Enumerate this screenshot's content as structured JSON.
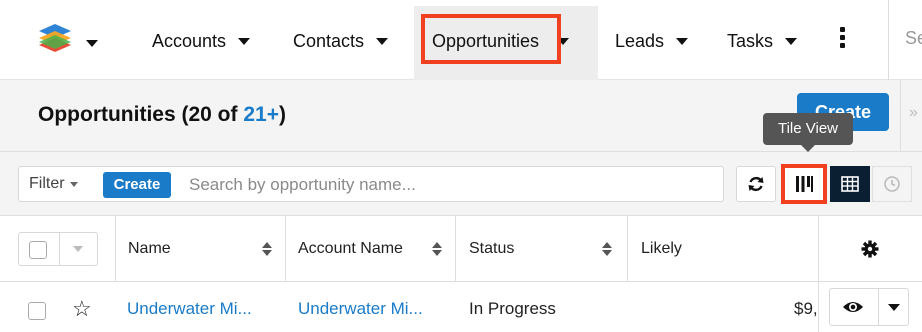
{
  "nav": {
    "items": [
      {
        "label": "Accounts"
      },
      {
        "label": "Contacts"
      },
      {
        "label": "Opportunities"
      },
      {
        "label": "Leads"
      },
      {
        "label": "Tasks"
      }
    ],
    "search_stub": "Se"
  },
  "header": {
    "title_prefix": "Opportunities (20 of ",
    "title_count": "21+",
    "title_suffix": ")",
    "create_label": "Create",
    "side_toggle": "»"
  },
  "tooltip": "Tile View",
  "filter": {
    "filter_label": "Filter",
    "create_label": "Create",
    "search_placeholder": "Search by opportunity name..."
  },
  "table": {
    "columns": [
      "Name",
      "Account Name",
      "Status",
      "Likely"
    ],
    "rows": [
      {
        "name": "Underwater Mi...",
        "account": "Underwater Mi...",
        "status": "In Progress",
        "likely": "$9,"
      }
    ]
  },
  "colors": {
    "accent": "#1a7bc9",
    "highlight": "#f04020",
    "active_view": "#0b1f33"
  },
  "icons": [
    "logo-icon",
    "more-icon",
    "refresh-icon",
    "tile-view-icon",
    "list-view-icon",
    "activity-stream-icon",
    "gear-icon",
    "star-icon",
    "eye-icon"
  ]
}
